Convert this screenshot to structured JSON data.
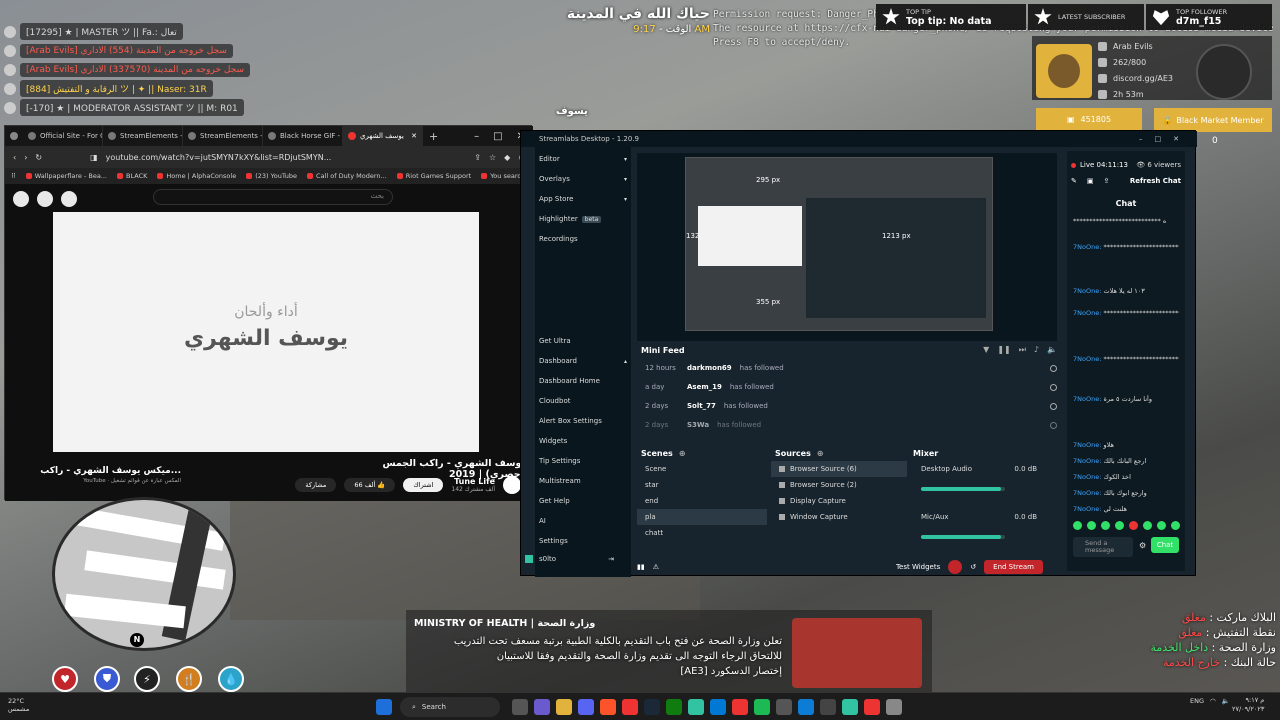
{
  "game_chat": [
    {
      "text": "[17295] ★ | MASTER ツ || Fa.: تعال",
      "color": "grey"
    },
    {
      "text": "[Arab Evils] سجل خروجه من المدينة (554) الاداري",
      "color": "red"
    },
    {
      "text": "[Arab Evils] سجل خروجه من المدينة (337570) الاداري",
      "color": "red"
    },
    {
      "text": "[884] الرقابة و التفتيش ツ | ✦ || Naser: 31R",
      "color": "gold"
    },
    {
      "text": "[-170] ★ | MODERATOR ASSISTANT ツ || M: R01",
      "color": "grey"
    }
  ],
  "welcome": {
    "line1": "حياك الله في المدينة",
    "time_label": "الوقت -",
    "time": "9:17 AM"
  },
  "permission": {
    "line1": "Permission request: Danger_Ph",
    "line2": "The resource at https://cfx-nui-danger_phone/ is requesting your permission to access media devices.",
    "line3": "Press F8 to accept/deny."
  },
  "alerts": {
    "top_tip_label": "TOP TIP",
    "top_tip_value": "Top tip: No data",
    "latest_sub_label": "LATEST SUBSCRIBER",
    "top_follower_label": "TOP FOLLOWER",
    "top_follower_value": "d7m_f15"
  },
  "social": {
    "team": "Arab Evils",
    "stat": "262/800",
    "discord": "discord.gg/AE3",
    "time": "2h 53m",
    "score": "451805",
    "market_label": "Black Market Member",
    "market_count": "0"
  },
  "player_name": "يسوف",
  "browser": {
    "tabs": [
      "Official Site - For Glo",
      "StreamElements - En",
      "StreamElements - En",
      "Black Horse GIF - Fin",
      "يوسف الشهري"
    ],
    "url": "youtube.com/watch?v=jutSMYN7kXY&list=RDjutSMYN...",
    "bookmarks": [
      "Wallpaperflare - Bea...",
      "BLACK",
      "Home | AlphaConsole",
      "(23) YouTube",
      "Call of Duty Modern...",
      "Riot Games Support",
      "You searched for un..."
    ],
    "search_placeholder": "بحث",
    "video_line1": "أداء وألحان",
    "video_line2": "يوسف الشهري",
    "video_title": "يوسف الشهري - راكب الجمس (حصري) | 2019",
    "channel": "Tune Life",
    "channel_sub": "142 ألف مشترك",
    "subscribe": "اشتراك",
    "likes": "66 ألف",
    "share": "مشاركة",
    "side_title": "ميكس يوسف الشهري - راكب...",
    "side_sub": "YouTube · المكس عبارة عن قوائم تشغيل"
  },
  "streamlabs": {
    "title": "Streamlabs Desktop - 1.20.9",
    "nav": [
      "Editor",
      "Overlays",
      "App Store",
      "Highlighter",
      "Recordings",
      "Get Ultra",
      "Dashboard",
      "Dashboard Home",
      "Cloudbot",
      "Alert Box Settings",
      "Widgets",
      "Tip Settings",
      "Multistream",
      "Get Help",
      "AI",
      "Settings"
    ],
    "highlighter_badge": "beta",
    "user": "s0lto",
    "px_labels": [
      "295 px",
      "132",
      "1213 px",
      "355 px"
    ],
    "minifeed": "Mini Feed",
    "feed": [
      {
        "time": "12 hours",
        "user": "darkmon69",
        "action": "has followed"
      },
      {
        "time": "a day",
        "user": "Asem_19",
        "action": "has followed"
      },
      {
        "time": "2 days",
        "user": "Solt_77",
        "action": "has followed"
      },
      {
        "time": "2 days",
        "user": "S3Wa",
        "action": "has followed"
      }
    ],
    "scenes_label": "Scenes",
    "scenes": [
      "Scene",
      "star",
      "end",
      "pla",
      "chatt"
    ],
    "sources_label": "Sources",
    "sources": [
      "Browser Source (6)",
      "Browser Source (2)",
      "Display Capture",
      "Window Capture"
    ],
    "mixer_label": "Mixer",
    "mixer": [
      {
        "name": "Desktop Audio",
        "db": "0.0 dB",
        "level": 0.95
      },
      {
        "name": "Mic/Aux",
        "db": "0.0 dB",
        "level": 0.95
      }
    ],
    "test_widgets": "Test Widgets",
    "end_stream": "End Stream",
    "live": "Live 04:11:13",
    "viewers": "6 viewers",
    "refresh": "Refresh Chat",
    "chat_title": "Chat",
    "chat_lines": [
      {
        "user": "",
        "msg": "*************************** ه"
      },
      {
        "user": "7NoOne:",
        "msg": "*************************** ه"
      },
      {
        "user": "7NoOne:",
        "msg": "١٠٣ له يلا هلات"
      },
      {
        "user": "7NoOne:",
        "msg": "*************************** ه"
      },
      {
        "user": "7NoOne:",
        "msg": "*************************** ه"
      },
      {
        "user": "7NoOne:",
        "msg": "وأنا ساردت ٥ مرة"
      },
      {
        "user": "7NoOne:",
        "msg": "هلاو"
      },
      {
        "user": "7NoOne:",
        "msg": "ارجع البانك بالك"
      },
      {
        "user": "7NoOne:",
        "msg": "اخذ الكوك"
      },
      {
        "user": "7NoOne:",
        "msg": "وارجع ابوك بالك"
      },
      {
        "user": "7NoOne:",
        "msg": "هلنت لي"
      }
    ],
    "chat_placeholder": "Send a message",
    "chat_button": "Chat"
  },
  "news": {
    "header": "MINISTRY OF HEALTH | وزارة الصحة",
    "line1": "تعلن وزارة الصحة عن فتح باب التقديم بالكلية الطبية برتبة مسعف تحت التدريب",
    "line2": "للالتحاق الرجاء التوجه الى تقديم وزارة الصحة والتقديم وفقا للاستبيان",
    "line3": "[AE3] إختصار الدسكورد"
  },
  "status": [
    {
      "key": "البلاك ماركت",
      "value": "مغلق",
      "color": "red"
    },
    {
      "key": "نقطة التفتيش",
      "value": "مغلق",
      "color": "red"
    },
    {
      "key": "وزارة الصحة",
      "value": "داخل الخدمة",
      "color": "green"
    },
    {
      "key": "حالة البنك",
      "value": "خارج الخدمة",
      "color": "red"
    }
  ],
  "taskbar": {
    "weather_temp": "22°C",
    "weather_desc": "مشمس",
    "search": "Search",
    "lang": "ENG",
    "clock_time": "م ٩:١٧",
    "clock_date": "٢٧/٠٩/٢٠٢٣"
  }
}
